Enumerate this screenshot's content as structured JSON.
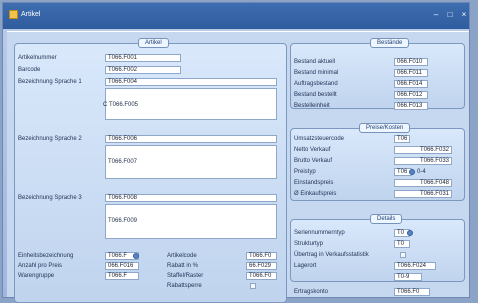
{
  "window": {
    "title": "Artikel",
    "minimize": "–",
    "maximize": "□",
    "close": "×"
  },
  "artikel": {
    "legend": "Artikel",
    "artikelnummer_label": "Artikelnummer",
    "artikelnummer": "T066.F001",
    "barcode_label": "Barcode",
    "barcode": "T066.F002",
    "bez1_label": "Bezeichnung Sprache 1",
    "bez1": "T066.F004",
    "bez1_text": "T066.F005",
    "bez1_text_prefix": "C",
    "bez2_label": "Bezeichnung Sprache 2",
    "bez2": "T066.F006",
    "bez2_text": "T066.F007",
    "bez3_label": "Bezeichnung Sprache 3",
    "bez3": "T066.F008",
    "bez3_text": "T066.F009",
    "einheit_label": "Einheitsbezeichnung",
    "einheit": "T066.F",
    "anzahl_label": "Anzahl pro Preis",
    "anzahl": "066.F016",
    "warengruppe_label": "Warengruppe",
    "warengruppe": "T066.F",
    "artikelcode_label": "Artikelcode",
    "artikelcode": "T066.F0",
    "rabatt_label": "Rabatt in %",
    "rabatt": "66.F029",
    "staffel_label": "Staffel/Raster",
    "staffel": "T066.F0",
    "rabattsperre_label": "Rabattsperre"
  },
  "bestaende": {
    "legend": "Bestände",
    "rows": [
      {
        "label": "Bestand aktuell",
        "value": "066.F010"
      },
      {
        "label": "Bestand minimal",
        "value": "066.F011"
      },
      {
        "label": "Auftragsbestand",
        "value": "066.F014"
      },
      {
        "label": "Bestand bestellt",
        "value": "066.F012"
      },
      {
        "label": "Bestelleinheit",
        "value": "066.F013"
      }
    ]
  },
  "preise": {
    "legend": "Preise/Kosten",
    "rows": [
      {
        "label": "Umsatzsteuercode",
        "value": "T06"
      },
      {
        "label": "Netto Verkauf",
        "value": "T066.F032"
      },
      {
        "label": "Brutto Verkauf",
        "value": "T066.F033"
      },
      {
        "label": "Preistyp",
        "value": "T06",
        "extra": "0-4"
      },
      {
        "label": "Einstandspreis",
        "value": "T066.F048"
      },
      {
        "label": "Ø Einkaufspreis",
        "value": "T066.F031"
      }
    ]
  },
  "details": {
    "legend": "Details",
    "seriennummer_label": "Seriennummerntyp",
    "seriennummer": "T0",
    "struktur_label": "Strukturtyp",
    "struktur": "T0",
    "uebertrag_label": "Übertrag in Verkaufsstatistik",
    "lagerort_label": "Lagerort",
    "lagerort": "T066.F024",
    "lager2": "T0-9",
    "ertrag_label": "Ertragskonto",
    "ertrag": "T066.F0"
  }
}
